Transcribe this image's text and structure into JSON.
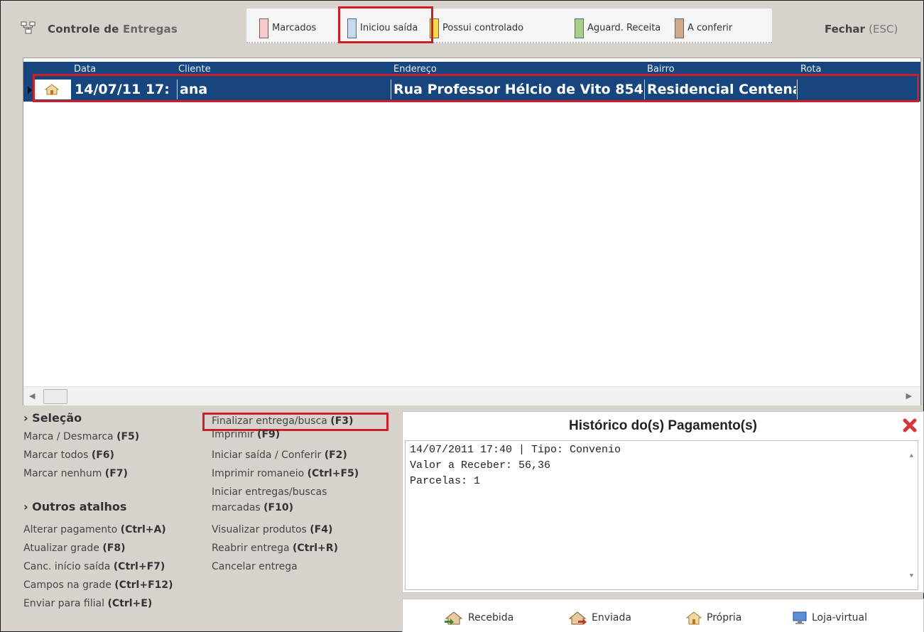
{
  "header": {
    "title_part1": "Controle de",
    "title_part2": "Entregas",
    "close_label": "Fechar",
    "close_key": "(ESC)"
  },
  "legend": [
    {
      "label": "Marcados",
      "color": "#f7c8cc"
    },
    {
      "label": "Iniciou saída",
      "color": "#c7d8ef"
    },
    {
      "label": "Possui controlado",
      "color": "#ffd54f"
    },
    {
      "label": "Aguard. Receita",
      "color": "#a8d08d"
    },
    {
      "label": "A conferir",
      "color": "#cfa98a"
    }
  ],
  "grid": {
    "columns": [
      "Data",
      "Cliente",
      "Endereço",
      "Bairro",
      "Rota"
    ],
    "rows": [
      {
        "data": "14/07/11 17:",
        "cliente": "ana",
        "endereco": "Rua Professor Hélcio de Vito 854",
        "bairro": "Residencial Centenár",
        "rota": ""
      }
    ]
  },
  "selection": {
    "title": "› Seleção",
    "items": [
      {
        "label": "Marca / Desmarca ",
        "key": "(F5)"
      },
      {
        "label": "Marcar todos ",
        "key": "(F6)"
      },
      {
        "label": "Marcar nenhum ",
        "key": "(F7)"
      }
    ]
  },
  "other": {
    "title": "› Outros atalhos",
    "items": [
      {
        "label": "Alterar pagamento ",
        "key": "(Ctrl+A)"
      },
      {
        "label": "Atualizar grade ",
        "key": "(F8)"
      },
      {
        "label": "Canc. início saída ",
        "key": "(Ctrl+F7)"
      },
      {
        "label": "Campos na grade  ",
        "key": "(Ctrl+F12)"
      },
      {
        "label": "Enviar para filial  ",
        "key": "(Ctrl+E)"
      }
    ]
  },
  "actions": {
    "items": [
      {
        "label": "Finalizar entrega/busca ",
        "key": "(F3)"
      },
      {
        "label": "Imprimir  ",
        "key": "(F9)"
      },
      {
        "label": "Iniciar saída / Conferir  ",
        "key": "(F2)"
      },
      {
        "label": "Imprimir romaneio ",
        "key": "(Ctrl+F5)"
      },
      {
        "label": "Iniciar entregas/buscas",
        "key": ""
      },
      {
        "label": "marcadas ",
        "key": "(F10)"
      },
      {
        "label": "Visualizar produtos ",
        "key": "(F4)"
      },
      {
        "label": "Reabrir entrega ",
        "key": "(Ctrl+R)"
      },
      {
        "label": "Cancelar entrega",
        "key": ""
      }
    ]
  },
  "history": {
    "title": "Histórico do(s) Pagamento(s)",
    "lines": [
      "14/07/2011 17:40 | Tipo: Convenio",
      "Valor a Receber: 56,36",
      "Parcelas: 1"
    ]
  },
  "bottom_legend": [
    {
      "label": "Recebida",
      "icon": "house-received-icon"
    },
    {
      "label": "Enviada",
      "icon": "house-sent-icon"
    },
    {
      "label": "Própria",
      "icon": "house-own-icon"
    },
    {
      "label": "Loja-virtual",
      "icon": "monitor-icon"
    }
  ]
}
